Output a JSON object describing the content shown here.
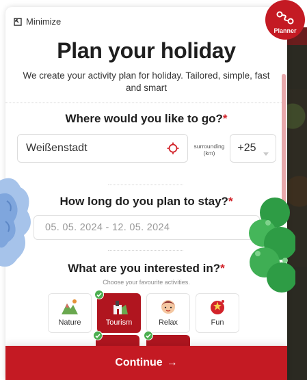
{
  "header": {
    "minimize_label": "Minimize",
    "planner_label": "Planner"
  },
  "hero": {
    "title": "Plan your holiday",
    "subtitle": "We create your activity plan for holiday. Tailored, simple, fast and smart"
  },
  "destination": {
    "question": "Where would you like to go?",
    "required_mark": "*",
    "value": "Weißenstadt",
    "surrounding_label_line1": "surrounding",
    "surrounding_label_line2": "(km)",
    "radius_value": "+25"
  },
  "duration": {
    "question": "How long do you plan to stay?",
    "required_mark": "*",
    "date_range": "05. 05. 2024 - 12. 05. 2024"
  },
  "interests": {
    "question": "What are you interested in?",
    "required_mark": "*",
    "hint": "Choose your favourite activities.",
    "categories": [
      {
        "label": "Nature",
        "selected": false,
        "icon": "nature-icon"
      },
      {
        "label": "Tourism",
        "selected": true,
        "icon": "tourism-icon"
      },
      {
        "label": "Relax",
        "selected": false,
        "icon": "relax-icon"
      },
      {
        "label": "Fun",
        "selected": false,
        "icon": "fun-icon"
      }
    ]
  },
  "footer": {
    "continue_label": "Continue",
    "continue_arrow": "→"
  },
  "colors": {
    "brand_red": "#c41a23",
    "selected_red": "#b0151f",
    "check_green": "#4caf50"
  }
}
